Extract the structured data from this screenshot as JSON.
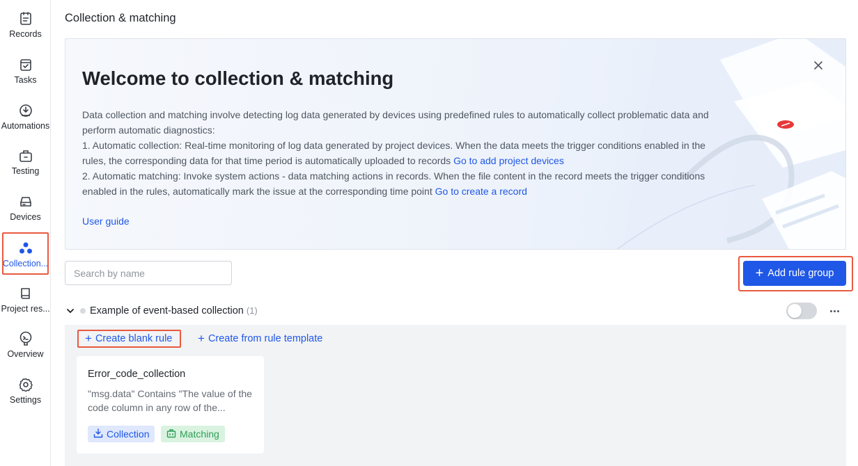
{
  "sidebar": {
    "items": [
      {
        "label": "Records",
        "icon": "records-icon"
      },
      {
        "label": "Tasks",
        "icon": "tasks-icon"
      },
      {
        "label": "Automations",
        "icon": "automations-icon"
      },
      {
        "label": "Testing",
        "icon": "testing-icon"
      },
      {
        "label": "Devices",
        "icon": "devices-icon"
      },
      {
        "label": "Collection...",
        "icon": "collection-icon",
        "active": true
      },
      {
        "label": "Project res...",
        "icon": "project-resources-icon"
      },
      {
        "label": "Overview",
        "icon": "overview-icon"
      },
      {
        "label": "Settings",
        "icon": "gear-icon"
      }
    ]
  },
  "page": {
    "title": "Collection & matching"
  },
  "banner": {
    "title": "Welcome to collection & matching",
    "intro": "Data collection and matching involve detecting log data generated by devices using predefined rules to automatically collect problematic data and perform automatic diagnostics:",
    "item1": "1. Automatic collection: Real-time monitoring of log data generated by project devices. When the data meets the trigger conditions enabled in the rules, the corresponding data for that time period is automatically uploaded to records",
    "item1_link": "Go to add project devices",
    "item2": "2. Automatic matching: Invoke system actions - data matching actions in records. When the file content in the record meets the trigger conditions enabled in the rules, automatically mark the issue at the corresponding time point",
    "item2_link": "Go to create a record",
    "guide_link": "User guide"
  },
  "search": {
    "placeholder": "Search by name",
    "value": ""
  },
  "toolbar": {
    "add_rule_group": "Add rule group"
  },
  "group": {
    "title": "Example of event-based collection",
    "count": "(1)",
    "enabled": false,
    "create_blank": "Create blank rule",
    "create_template": "Create from rule template",
    "rules": [
      {
        "name": "Error_code_collection",
        "description": "\"msg.data\" Contains \"The value of the code column in any row of the...",
        "tags": [
          "Collection",
          "Matching"
        ]
      }
    ]
  },
  "colors": {
    "accent": "#1f57e6",
    "highlight": "#e8593f",
    "match_green": "#2f9e58"
  }
}
